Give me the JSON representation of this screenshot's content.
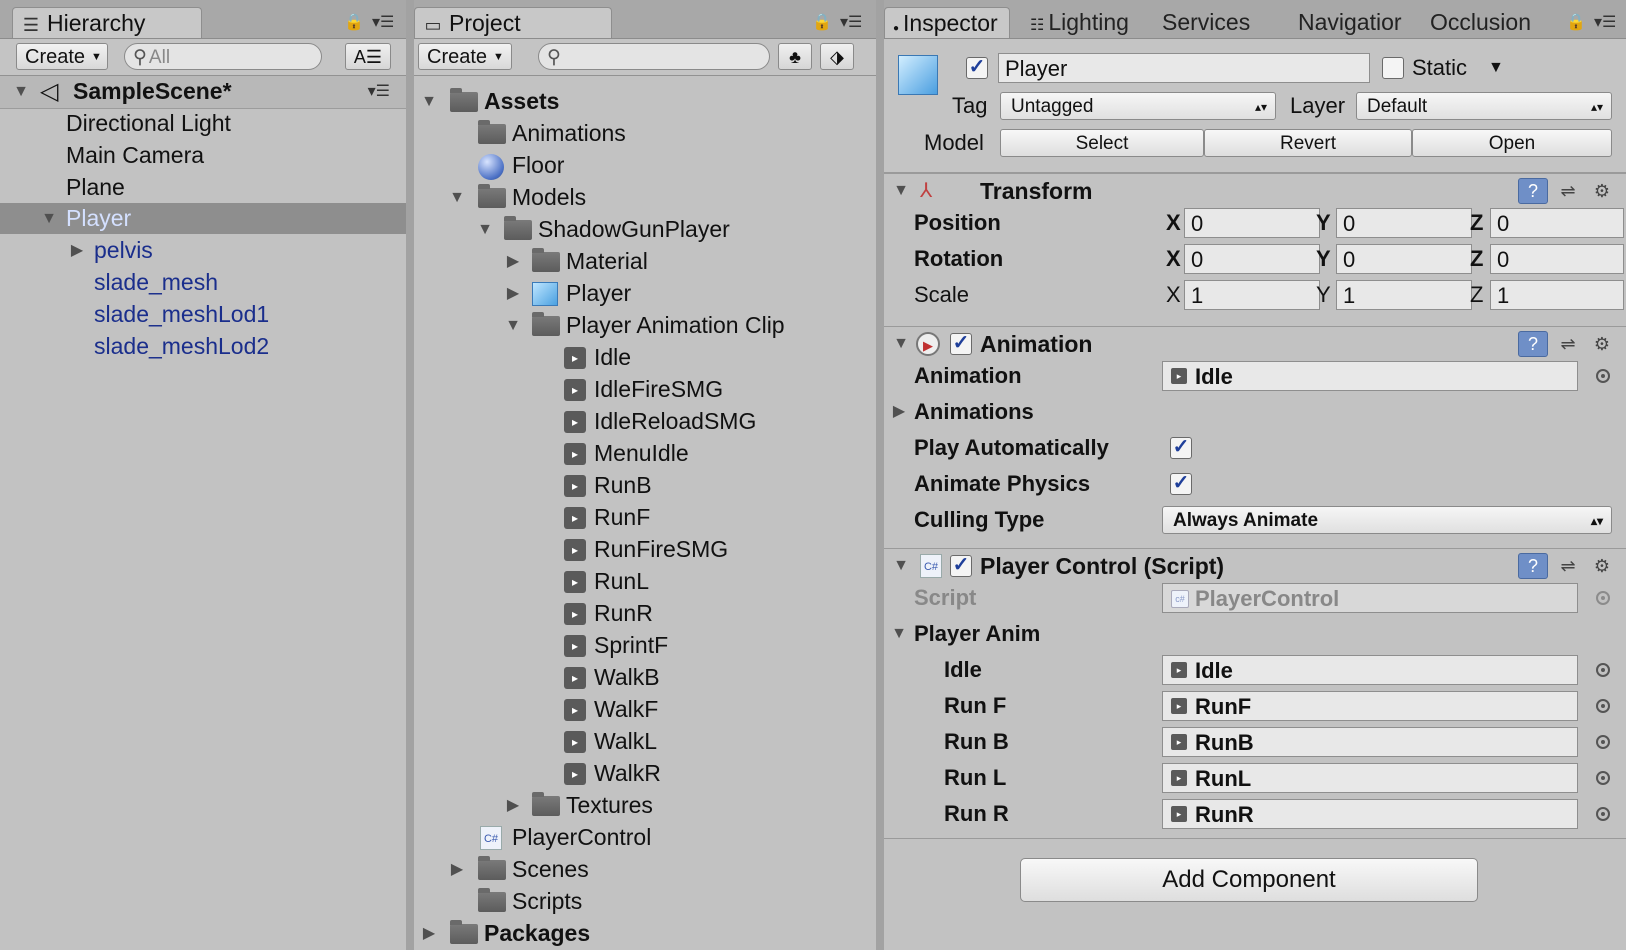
{
  "hierarchy": {
    "tab_title": "Hierarchy",
    "create_label": "Create",
    "search_placeholder": "All",
    "scene_name": "SampleScene*",
    "items": [
      {
        "label": "Directional Light"
      },
      {
        "label": "Main Camera"
      },
      {
        "label": "Plane"
      },
      {
        "label": "Player"
      },
      {
        "label": "pelvis"
      },
      {
        "label": "slade_mesh"
      },
      {
        "label": "slade_meshLod1"
      },
      {
        "label": "slade_meshLod2"
      }
    ]
  },
  "project": {
    "tab_title": "Project",
    "create_label": "Create",
    "search_placeholder": "",
    "items": [
      {
        "label": "Assets"
      },
      {
        "label": "Animations"
      },
      {
        "label": "Floor"
      },
      {
        "label": "Models"
      },
      {
        "label": "ShadowGunPlayer"
      },
      {
        "label": "Material"
      },
      {
        "label": "Player"
      },
      {
        "label": "Player Animation Clip"
      },
      {
        "label": "Idle"
      },
      {
        "label": "IdleFireSMG"
      },
      {
        "label": "IdleReloadSMG"
      },
      {
        "label": "MenuIdle"
      },
      {
        "label": "RunB"
      },
      {
        "label": "RunF"
      },
      {
        "label": "RunFireSMG"
      },
      {
        "label": "RunL"
      },
      {
        "label": "RunR"
      },
      {
        "label": "SprintF"
      },
      {
        "label": "WalkB"
      },
      {
        "label": "WalkF"
      },
      {
        "label": "WalkL"
      },
      {
        "label": "WalkR"
      },
      {
        "label": "Textures"
      },
      {
        "label": "PlayerControl"
      },
      {
        "label": "Scenes"
      },
      {
        "label": "Scripts"
      },
      {
        "label": "Packages"
      }
    ]
  },
  "inspector": {
    "tabs": [
      "Inspector",
      "Lighting",
      "Services",
      "Navigatior",
      "Occlusion"
    ],
    "object_name": "Player",
    "static_label": "Static",
    "tag_label": "Tag",
    "tag_value": "Untagged",
    "layer_label": "Layer",
    "layer_value": "Default",
    "model_label": "Model",
    "model_buttons": [
      "Select",
      "Revert",
      "Open"
    ],
    "transform": {
      "title": "Transform",
      "rows": [
        {
          "label": "Position",
          "x": "0",
          "y": "0",
          "z": "0"
        },
        {
          "label": "Rotation",
          "x": "0",
          "y": "0",
          "z": "0"
        },
        {
          "label": "Scale",
          "x": "1",
          "y": "1",
          "z": "1"
        }
      ],
      "axes": [
        "X",
        "Y",
        "Z"
      ]
    },
    "animation": {
      "title": "Animation",
      "animation_label": "Animation",
      "animation_value": "Idle",
      "animations_label": "Animations",
      "play_auto_label": "Play Automatically",
      "animate_physics_label": "Animate Physics",
      "culling_label": "Culling Type",
      "culling_value": "Always Animate"
    },
    "player_control": {
      "title": "Player Control (Script)",
      "script_label": "Script",
      "script_value": "PlayerControl",
      "player_anim_label": "Player Anim",
      "rows": [
        {
          "label": "Idle",
          "value": "Idle"
        },
        {
          "label": "Run F",
          "value": "RunF"
        },
        {
          "label": "Run B",
          "value": "RunB"
        },
        {
          "label": "Run L",
          "value": "RunL"
        },
        {
          "label": "Run R",
          "value": "RunR"
        }
      ]
    },
    "add_component_label": "Add Component"
  }
}
